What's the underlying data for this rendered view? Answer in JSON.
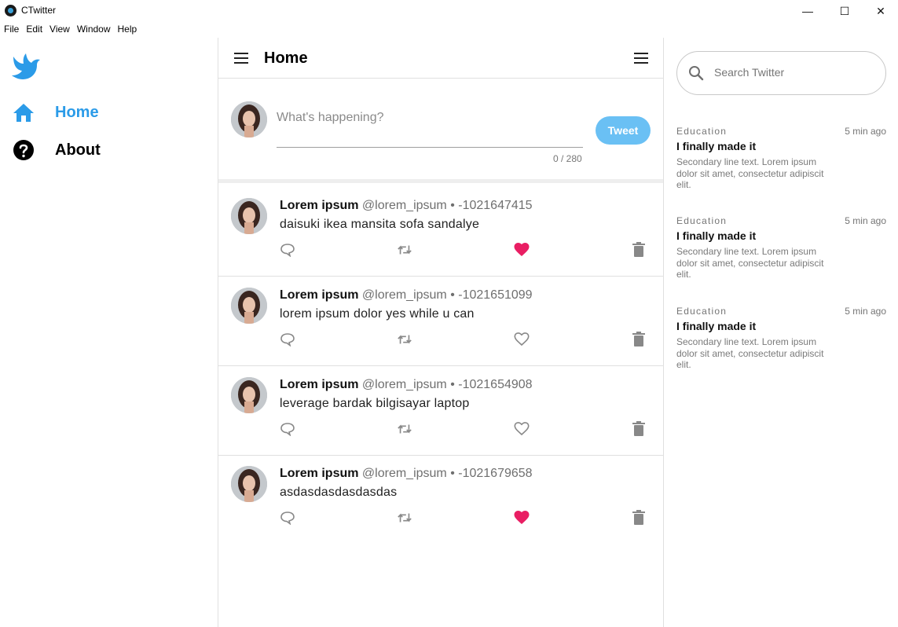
{
  "window": {
    "title": "CTwitter",
    "minimize": "—",
    "maximize": "☐",
    "close": "✕"
  },
  "menu": [
    "File",
    "Edit",
    "View",
    "Window",
    "Help"
  ],
  "colors": {
    "accent": "#2b9be8",
    "tweet_button": "#6ac0f4",
    "liked": "#e91e63",
    "icon_gray": "#888888"
  },
  "nav": {
    "items": [
      {
        "label": "Home",
        "icon": "home-icon",
        "active": true
      },
      {
        "label": "About",
        "icon": "help-circle-icon",
        "active": false
      }
    ]
  },
  "header": {
    "title": "Home"
  },
  "composer": {
    "placeholder": "What's happening?",
    "counter": "0 / 280",
    "button": "Tweet"
  },
  "tweets": [
    {
      "name": "Lorem ipsum",
      "handle": "@lorem_ipsum • -1021647415",
      "text": "daisuki ikea mansita sofa sandalye",
      "liked": true
    },
    {
      "name": "Lorem ipsum",
      "handle": "@lorem_ipsum • -1021651099",
      "text": "lorem ipsum dolor yes while u can",
      "liked": false
    },
    {
      "name": "Lorem ipsum",
      "handle": "@lorem_ipsum • -1021654908",
      "text": "leverage bardak bilgisayar laptop",
      "liked": false
    },
    {
      "name": "Lorem ipsum",
      "handle": "@lorem_ipsum • -1021679658",
      "text": "asdasdasdasdasdas",
      "liked": true
    }
  ],
  "search": {
    "placeholder": "Search Twitter"
  },
  "trends": [
    {
      "category": "Education",
      "time": "5 min ago",
      "title": "I finally made it",
      "desc": "Secondary line text. Lorem ipsum dolor sit amet, consectetur adipiscit elit."
    },
    {
      "category": "Education",
      "time": "5 min ago",
      "title": "I finally made it",
      "desc": "Secondary line text. Lorem ipsum dolor sit amet, consectetur adipiscit elit."
    },
    {
      "category": "Education",
      "time": "5 min ago",
      "title": "I finally made it",
      "desc": "Secondary line text. Lorem ipsum dolor sit amet, consectetur adipiscit elit."
    }
  ]
}
